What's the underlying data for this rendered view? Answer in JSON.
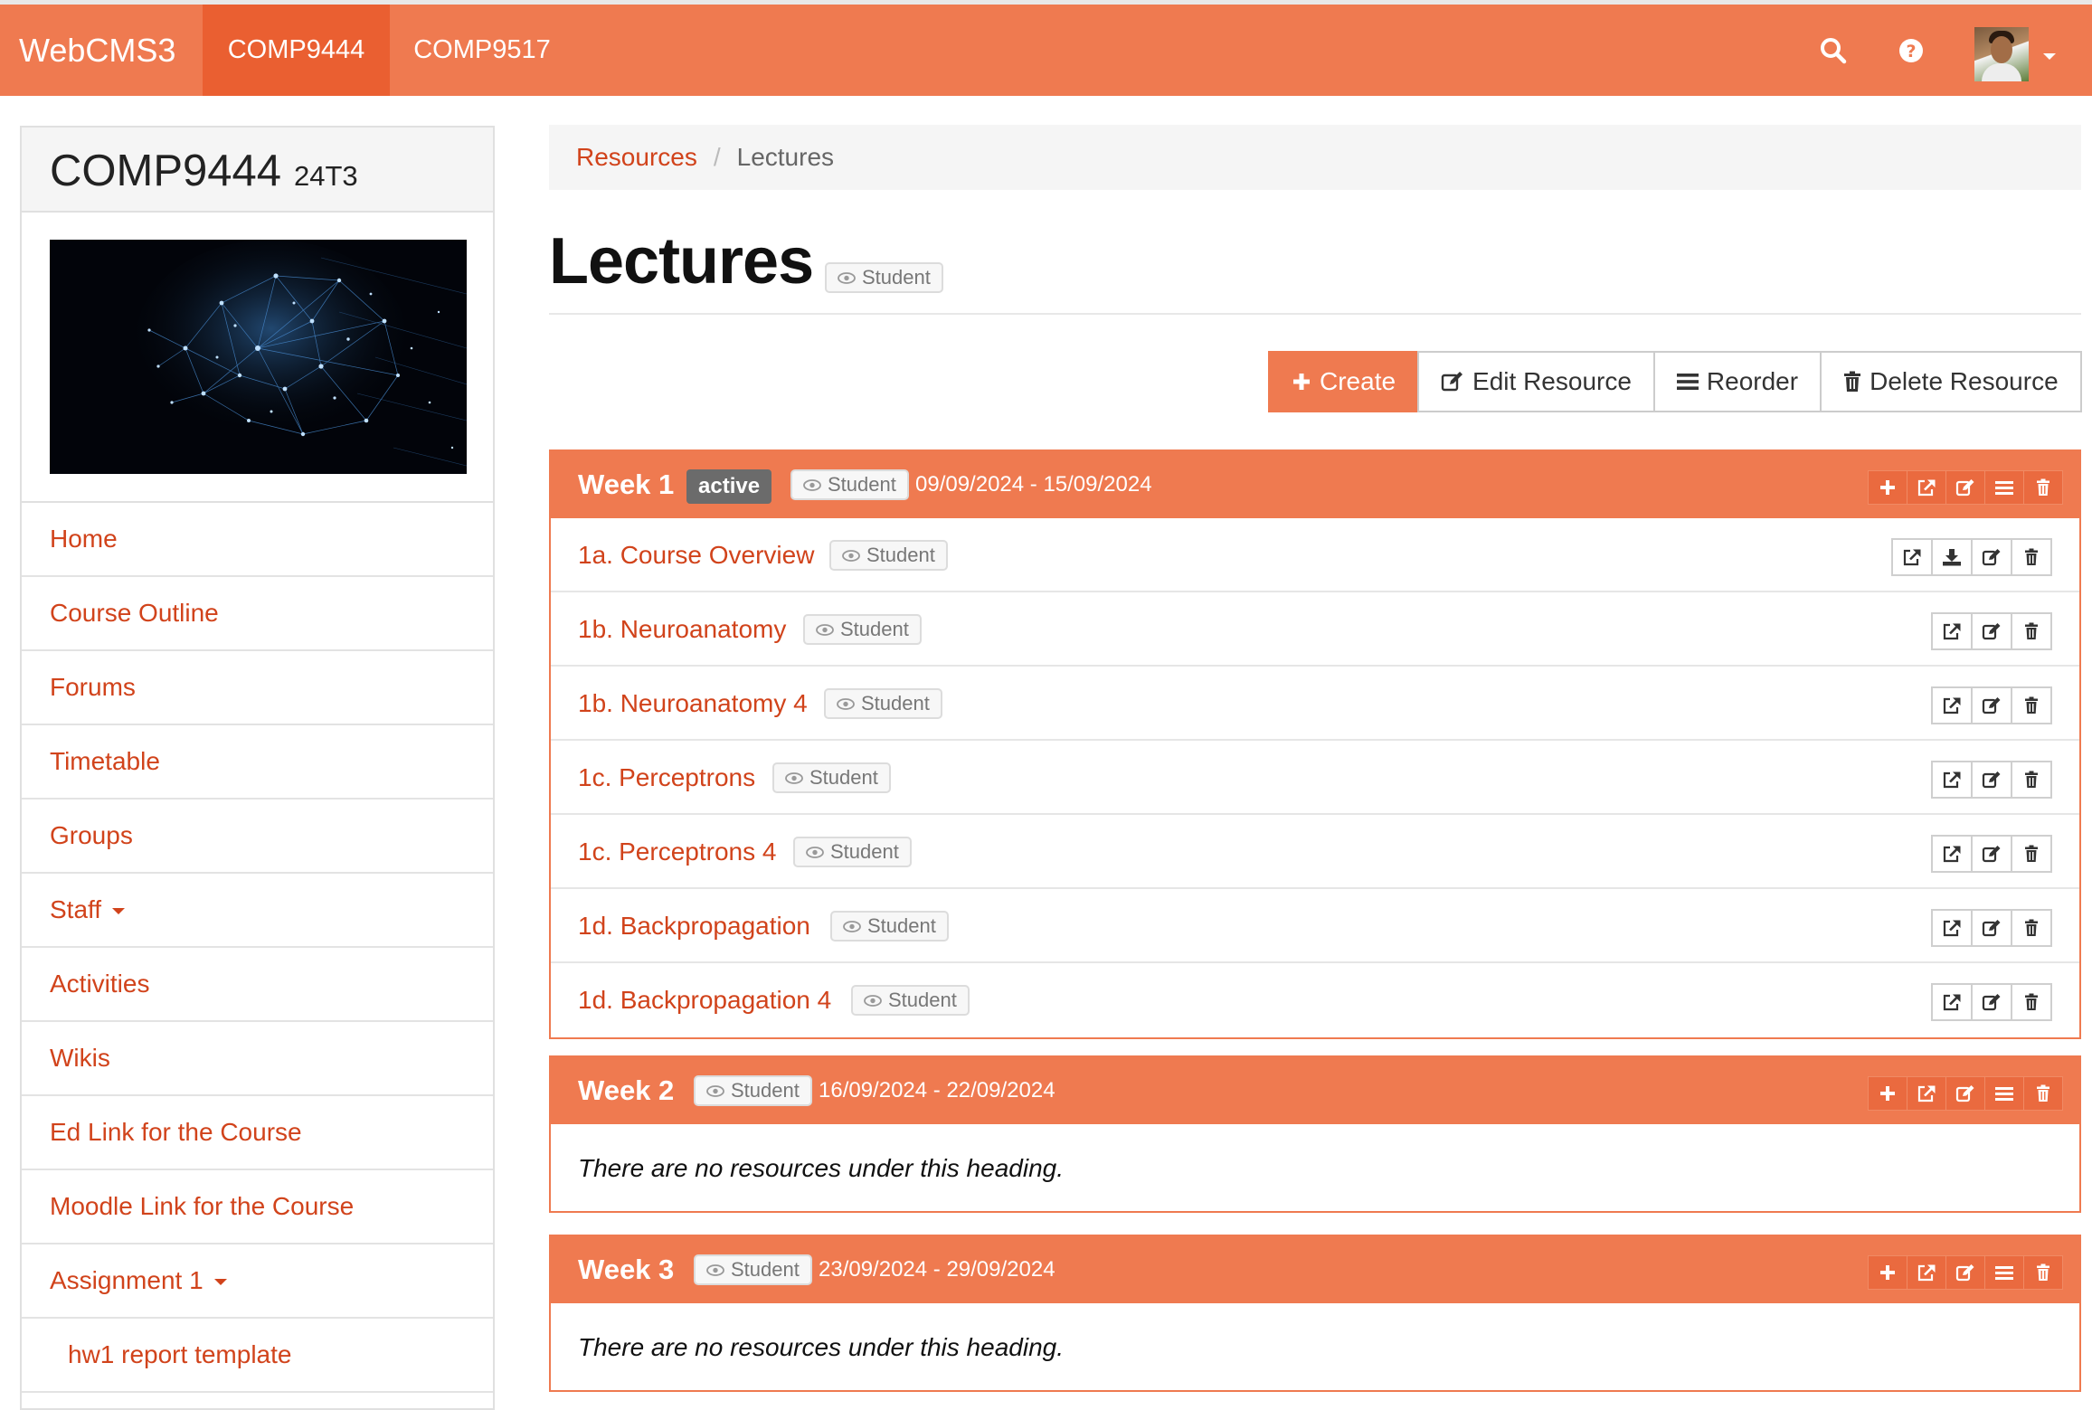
{
  "navbar": {
    "brand": "WebCMS3",
    "tabs": [
      {
        "label": "COMP9444",
        "active": true
      },
      {
        "label": "COMP9517",
        "active": false
      }
    ],
    "icons": [
      "search-icon",
      "help-icon",
      "avatar",
      "caret-down-icon"
    ]
  },
  "course": {
    "code": "COMP9444",
    "term": "24T3"
  },
  "sidebar": {
    "items": [
      {
        "label": "Home"
      },
      {
        "label": "Course Outline"
      },
      {
        "label": "Forums"
      },
      {
        "label": "Timetable"
      },
      {
        "label": "Groups"
      },
      {
        "label": "Staff",
        "dropdown": true
      },
      {
        "label": "Activities"
      },
      {
        "label": "Wikis"
      },
      {
        "label": "Ed Link for the Course"
      },
      {
        "label": "Moodle Link for the Course"
      },
      {
        "label": "Assignment 1",
        "dropdown": true
      },
      {
        "label": "hw1 report template",
        "sub": true
      }
    ]
  },
  "breadcrumb": {
    "parent": "Resources",
    "separator": "/",
    "current": "Lectures"
  },
  "page": {
    "title": "Lectures",
    "visibility": "Student"
  },
  "toolbar": {
    "create": "Create",
    "edit": "Edit Resource",
    "reorder": "Reorder",
    "delete": "Delete Resource"
  },
  "weeks": [
    {
      "title": "Week 1",
      "active_label": "active",
      "visibility": "Student",
      "dates": "09/09/2024 - 15/09/2024",
      "resources": [
        {
          "title": "1a. Course Overview",
          "visibility": "Student",
          "downloadable": true
        },
        {
          "title": "1b. Neuroanatomy",
          "visibility": "Student"
        },
        {
          "title": "1b. Neuroanatomy 4",
          "visibility": "Student"
        },
        {
          "title": "1c. Perceptrons",
          "visibility": "Student"
        },
        {
          "title": "1c. Perceptrons 4",
          "visibility": "Student"
        },
        {
          "title": "1d. Backpropagation",
          "visibility": "Student"
        },
        {
          "title": "1d. Backpropagation 4",
          "visibility": "Student"
        }
      ]
    },
    {
      "title": "Week 2",
      "visibility": "Student",
      "dates": "16/09/2024 - 22/09/2024",
      "empty_text": "There are no resources under this heading."
    },
    {
      "title": "Week 3",
      "visibility": "Student",
      "dates": "23/09/2024 - 29/09/2024",
      "empty_text": "There are no resources under this heading."
    }
  ],
  "colors": {
    "primary": "#ef7a50",
    "primary_dark": "#ea5f31",
    "link": "#d1431b",
    "active_badge": "#6b6b6b"
  }
}
